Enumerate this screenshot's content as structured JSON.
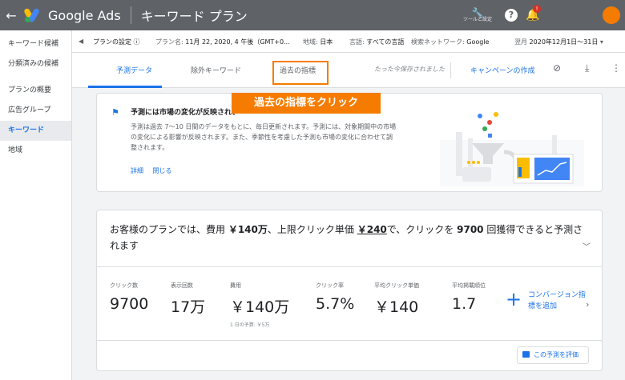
{
  "topbar": {
    "back_icon": "arrow-back-icon",
    "app_name": "Google Ads",
    "page_title": "キーワード プラン",
    "tools_label": "ツールと設定",
    "help_icon": "help-icon",
    "notification_badge": "!"
  },
  "sidebar": {
    "items": [
      {
        "label": "キーワード候補"
      },
      {
        "label": "分類済みの候補"
      },
      {
        "label": "プランの概要"
      },
      {
        "label": "広告グループ"
      },
      {
        "label": "キーワード"
      },
      {
        "label": "地域"
      }
    ],
    "active_index": 4
  },
  "settings": {
    "label": "プランの設定",
    "plan_name_key": "プラン名:",
    "plan_name_value": "11月 22, 2020, 4 午後（GMT+0...",
    "region_key": "地域:",
    "region_value": "日本",
    "language_key": "言語:",
    "language_value": "すべての言語",
    "network_key": "検索ネットワーク:",
    "network_value": "Google",
    "month_key": "翌月",
    "month_value": "2020年12月1日～31日"
  },
  "tabs": [
    {
      "label": "予測データ"
    },
    {
      "label": "除外キーワード"
    },
    {
      "label": "過去の指標"
    }
  ],
  "saved_text": "たった今保存されました",
  "create_campaign": "キャンペーンの作成",
  "callout": "過去の指標をクリック",
  "info": {
    "title": "予測には市場の変化が反映されます",
    "body": "予測は過去 7～10 日間のデータをもとに、毎日更新されます。予測には、対象期間中の市場の変化による影響が反映されます。また、季節性を考慮した予測も市場の変化に合わせて調整されます。",
    "link_details": "詳細",
    "link_close": "閉じる"
  },
  "forecast": {
    "head_pre": "お客様のプランでは、費用 ",
    "cost": "￥140万",
    "head_mid1": "、上限クリック単価 ",
    "cpc": "￥240",
    "head_mid2": "で、クリックを ",
    "clicks": "9700",
    "head_post": " 回獲得できると予測されます",
    "metrics": [
      {
        "label": "クリック数",
        "value": "9700"
      },
      {
        "label": "表示回数",
        "value": "17万"
      },
      {
        "label": "費用",
        "value": "￥140万"
      },
      {
        "label": "クリック率",
        "value": "5.7%"
      },
      {
        "label": "平均クリック単価",
        "value": "￥140"
      },
      {
        "label": "平均掲載順位",
        "value": "1.7"
      }
    ],
    "daily_budget": "1 日の予算: ￥5万",
    "conversion_add": "コンバージョン指標を追加",
    "evaluate_button": "この予測を評価"
  }
}
